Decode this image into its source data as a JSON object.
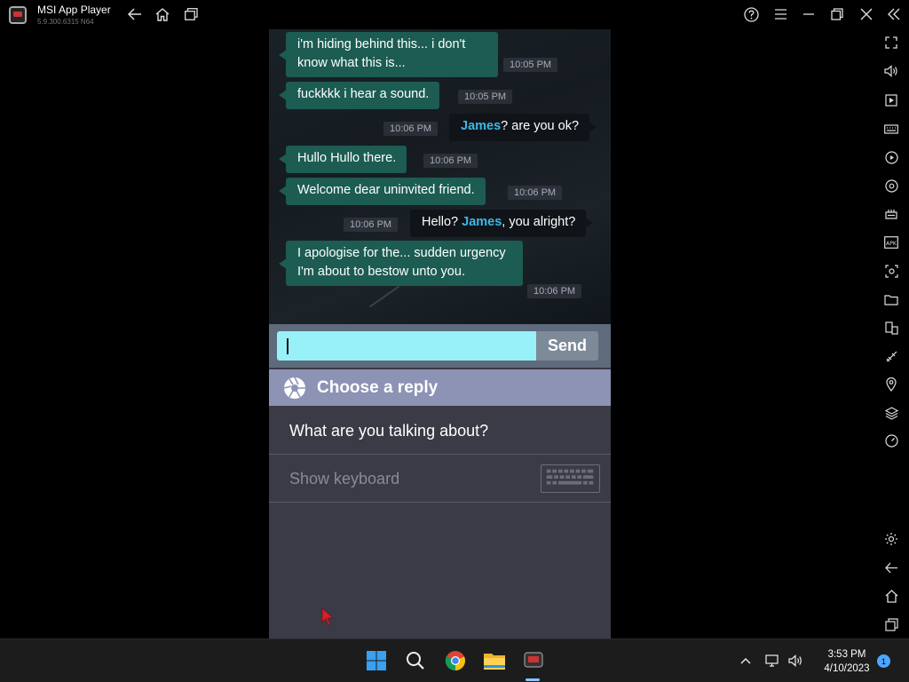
{
  "window": {
    "title": "MSI App Player",
    "version": "5.9.300.6315 N64"
  },
  "chat": {
    "messages": [
      {
        "sender": "them",
        "text": "i'm hiding behind this... i don't know what this is...",
        "time": "10:05 PM"
      },
      {
        "sender": "them",
        "text": "fuckkkk i hear a sound.",
        "time": "10:05 PM"
      },
      {
        "sender": "me",
        "name": "James",
        "text": "? are you ok?",
        "time": "10:06 PM"
      },
      {
        "sender": "them",
        "text": "Hullo Hullo there.",
        "time": "10:06 PM"
      },
      {
        "sender": "them",
        "text": "Welcome dear uninvited friend.",
        "time": "10:06 PM"
      },
      {
        "sender": "me",
        "prefix": "Hello? ",
        "name": "James",
        "text": ", you alright?",
        "time": "10:06 PM"
      },
      {
        "sender": "them",
        "text": "I apologise for the... sudden urgency I'm about to bestow unto you.",
        "time": "10:06 PM"
      }
    ]
  },
  "composer": {
    "value": "",
    "send_label": "Send"
  },
  "replies": {
    "header": "Choose a reply",
    "options": [
      "What are you talking about?"
    ],
    "show_keyboard_label": "Show keyboard"
  },
  "taskbar": {
    "time": "3:53 PM",
    "date": "4/10/2023",
    "notification_count": "1"
  },
  "colors": {
    "incoming_bubble": "#1c5c52",
    "outgoing_bubble": "#101418",
    "name_highlight": "#3cb8e8",
    "input_field": "#98f0f8",
    "reply_header": "#8c93b4"
  },
  "icons": {
    "titlebar": [
      "back-arrow-icon",
      "home-icon",
      "multi-window-icon",
      "help-icon",
      "menu-icon",
      "minimize-icon",
      "restore-icon",
      "close-icon",
      "collapse-sidebar-icon"
    ],
    "sidebar": [
      "fullscreen-icon",
      "volume-icon",
      "macro-icon",
      "keyboard-mapping-icon",
      "record-icon",
      "sync-icon",
      "controller-icon",
      "apk-install-icon",
      "screenshot-icon",
      "folder-icon",
      "multi-instance-icon",
      "eco-mode-icon",
      "location-icon",
      "layers-icon",
      "speed-icon",
      "settings-icon",
      "back-icon",
      "home-icon",
      "recent-apps-icon"
    ]
  }
}
